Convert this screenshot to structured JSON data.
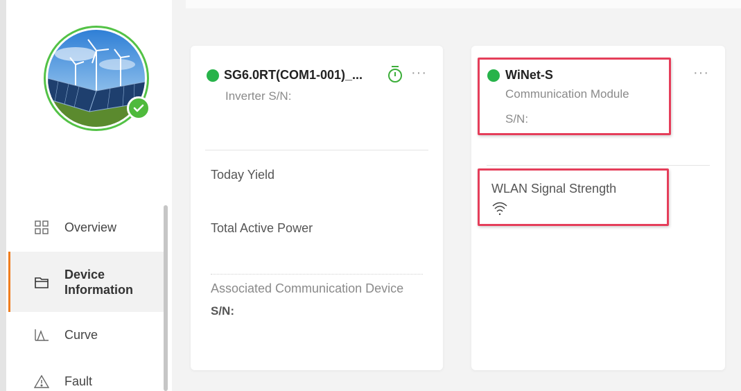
{
  "sidebar": {
    "items": [
      {
        "label": "Overview",
        "icon": "grid-icon"
      },
      {
        "label": "Device\nInformation",
        "icon": "folder-icon",
        "active": true
      },
      {
        "label": "Curve",
        "icon": "curve-icon"
      },
      {
        "label": "Fault",
        "icon": "warning-icon"
      }
    ]
  },
  "inverter_card": {
    "title": "SG6.0RT(COM1-001)_...",
    "subtitle": "Inverter  S/N:",
    "today_yield_label": "Today Yield",
    "total_active_power_label": "Total Active Power",
    "associated_label": "Associated Communication Device",
    "sn_label": "S/N:",
    "status_color": "#27b34a"
  },
  "winet_card": {
    "title": "WiNet-S",
    "subtitle": "Communication Module",
    "sn_label": "S/N:",
    "wlan_label": "WLAN Signal Strength",
    "status_color": "#27b34a"
  },
  "more_glyph": "···",
  "colors": {
    "accent": "#ef7d1f",
    "status_green": "#27b34a",
    "highlight_red": "#e53e5a"
  }
}
